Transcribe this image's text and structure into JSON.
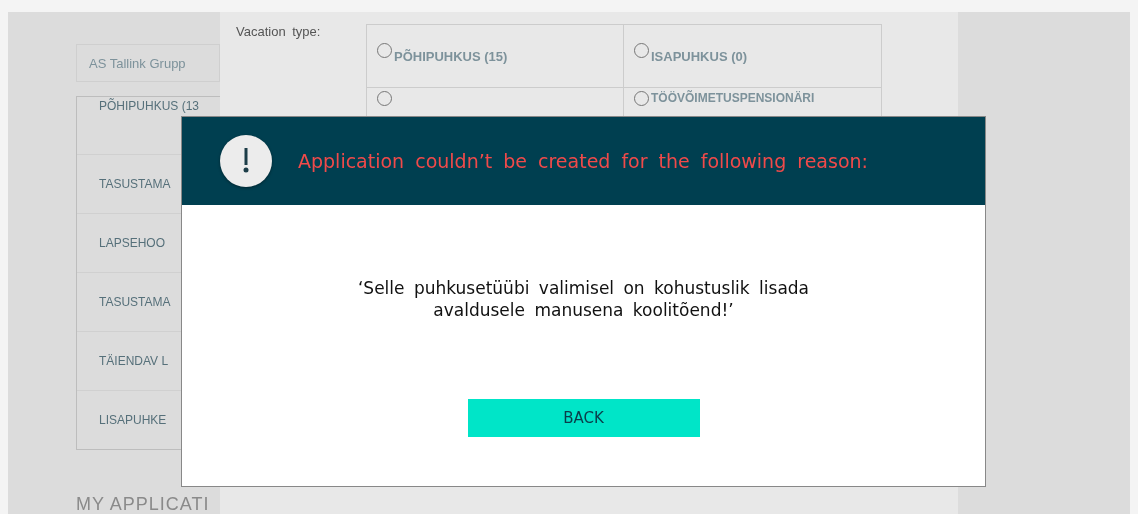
{
  "company": "AS Tallink Grupp",
  "sidebar": {
    "items": [
      {
        "label": "PÕHIPUHKUS (13"
      },
      {
        "label": "TASUSTAMA"
      },
      {
        "label": "LAPSEHOO"
      },
      {
        "label": "TASUSTAMA"
      },
      {
        "label": "TÄIENDAV L"
      },
      {
        "label": "LISAPUHKE"
      }
    ]
  },
  "section_heading": "MY APPLICATI",
  "vacation_type": {
    "label": "Vacation type:",
    "options": [
      {
        "label": "PÕHIPUHKUS (15)",
        "selected": false
      },
      {
        "label": "ISAPUHKUS (0)",
        "selected": false
      },
      {
        "selected": false
      },
      {
        "label": "TÖÖVÕIMETUSPENSIONÄRI",
        "selected": false
      }
    ]
  },
  "dialog": {
    "title": "Application couldn’t be created for the following reason:",
    "message": "‘Selle puhkusetüübi valimisel on kohustuslik lisada avaldusele manusena koolitõend!’",
    "button": "BACK"
  }
}
